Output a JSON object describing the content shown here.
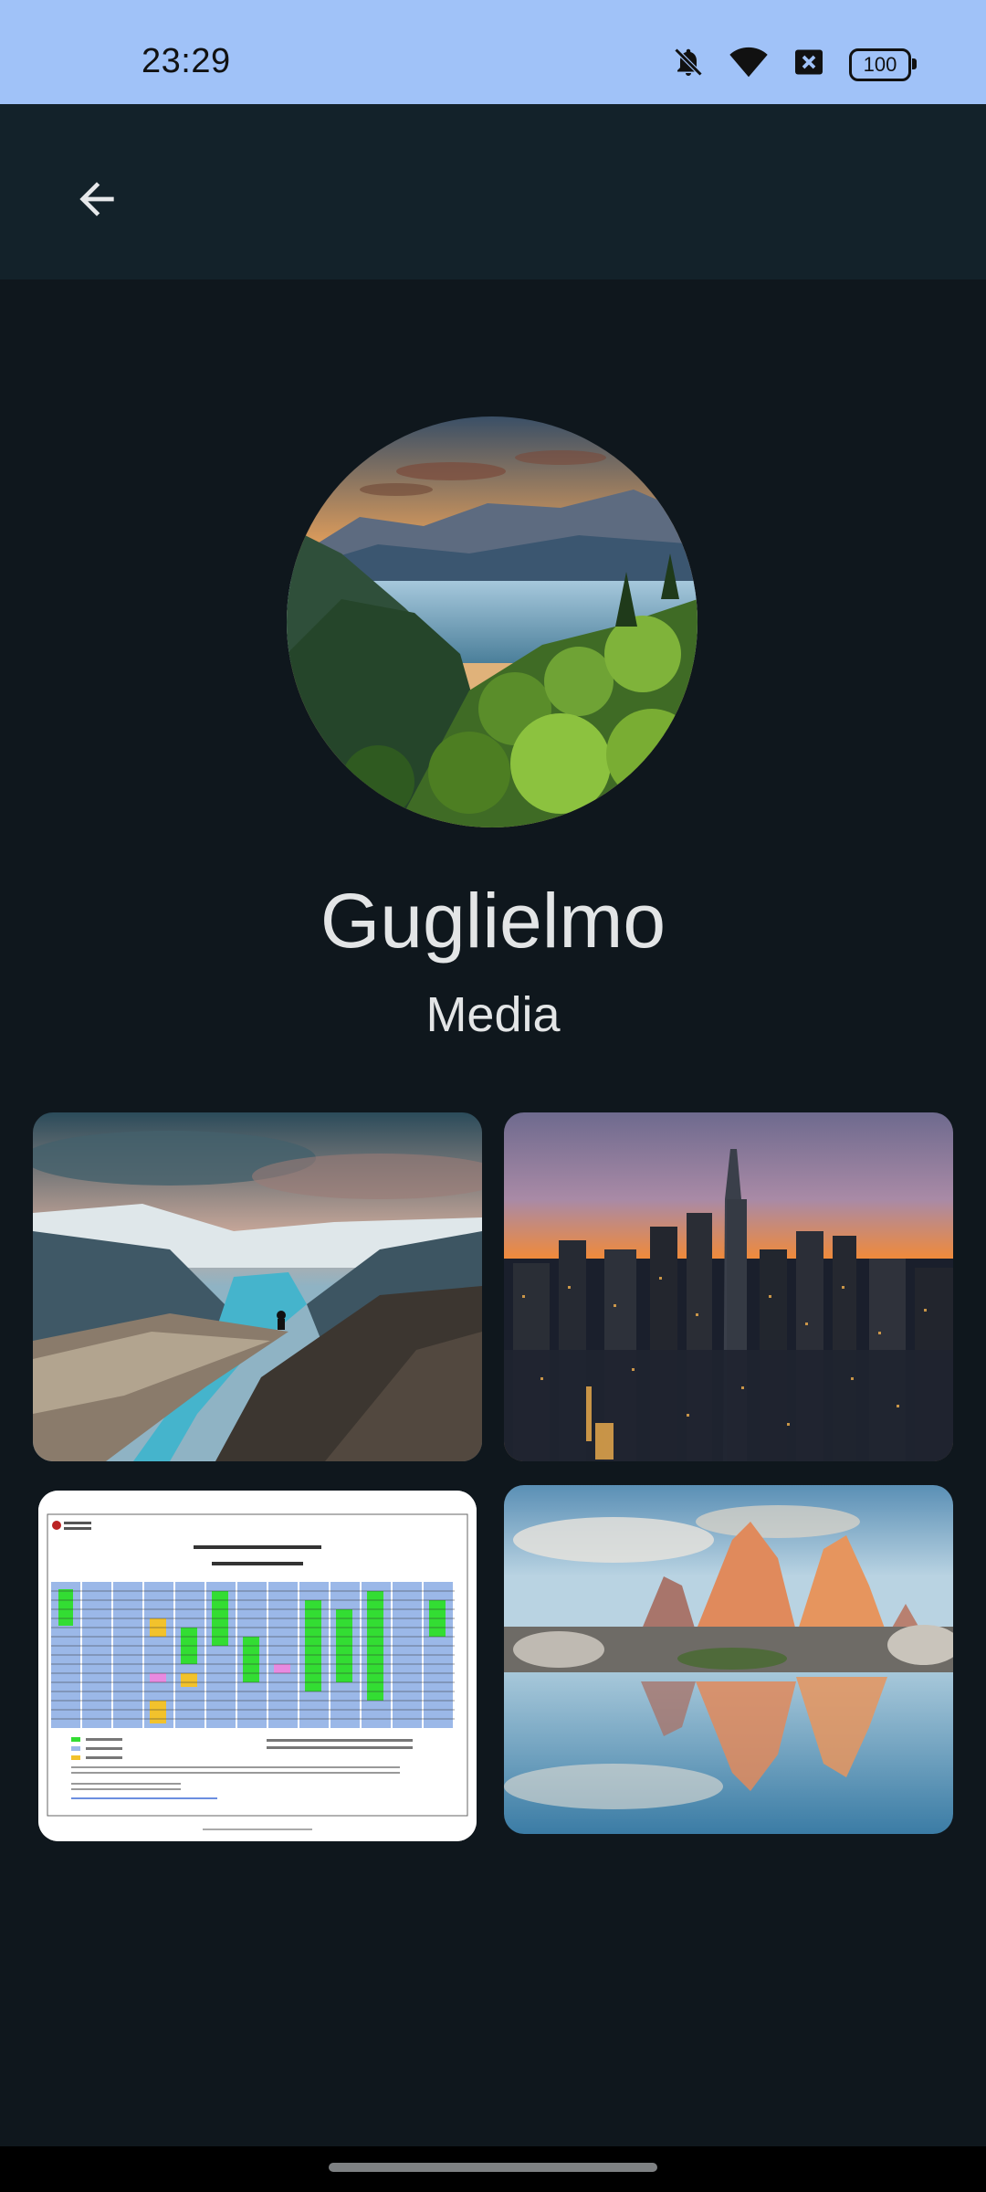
{
  "status": {
    "time": "23:29",
    "battery": "100",
    "icons": [
      "bell-off-icon",
      "wifi-icon",
      "no-sim-icon",
      "battery-icon"
    ]
  },
  "toolbar": {
    "back_icon": "arrow-left-icon"
  },
  "profile": {
    "name": "Guglielmo",
    "section": "Media"
  },
  "media": [
    {
      "kind": "photo",
      "subject": "fjord-cliff"
    },
    {
      "kind": "photo",
      "subject": "city-skyline-sunset"
    },
    {
      "kind": "document",
      "subject": "academic-calendar"
    },
    {
      "kind": "photo",
      "subject": "mountain-reflection"
    }
  ],
  "colors": {
    "status_bar": "#a0c2f8",
    "app_bar": "#13222a",
    "background": "#0f171d"
  }
}
